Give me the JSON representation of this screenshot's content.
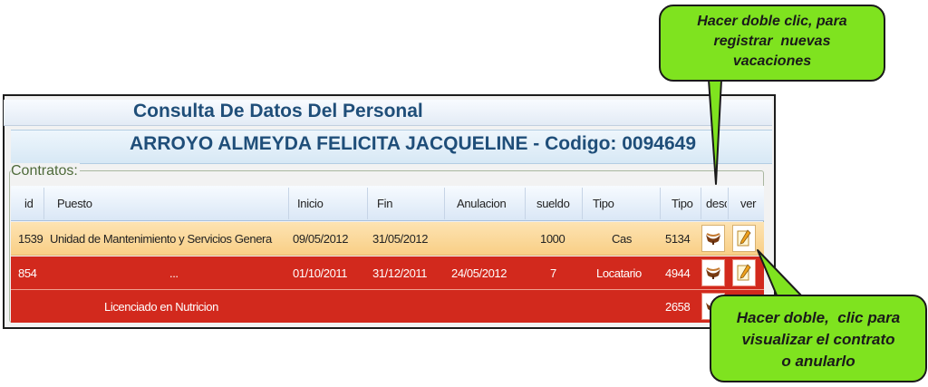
{
  "page": {
    "title": "Consulta De Datos Del Personal",
    "person_line": "ARROYO ALMEYDA FELICITA JACQUELINE - Codigo: 0094649"
  },
  "contracts": {
    "legend": "Contratos:",
    "headers": [
      "id",
      "Puesto",
      "Inicio",
      "Fin",
      "Anulacion",
      "sueldo",
      "Tipo",
      "Tipo",
      "desc",
      "ver"
    ],
    "rows": [
      {
        "id": "1539",
        "puesto": "Unidad de Mantenimiento y Servicios Genera",
        "inicio": "09/05/2012",
        "fin": "31/05/2012",
        "anulacion": "",
        "sueldo": "1000",
        "tipo": "Cas",
        "tipo2": "5134"
      },
      {
        "id": "854",
        "puesto": "...",
        "inicio": "01/10/2011",
        "fin": "31/12/2011",
        "anulacion": "24/05/2012",
        "sueldo": "7",
        "tipo": "Locatario",
        "tipo2": "4944"
      },
      {
        "id": "",
        "puesto": "Licenciado en Nutricion",
        "inicio": "",
        "fin": "",
        "anulacion": "",
        "sueldo": "",
        "tipo": "",
        "tipo2": "2658"
      }
    ],
    "row_colors": [
      "#f9cf86",
      "#d2291d",
      "#d2291d"
    ]
  },
  "callouts": {
    "top": [
      "Hacer doble clic, para",
      "registrar  nuevas",
      "vacaciones"
    ],
    "bottom": [
      "Hacer doble,  clic para",
      "visualizar el contrato",
      "o anularlo"
    ]
  },
  "icons": {
    "desc": "vacation-cup-icon",
    "ver": "edit-document-icon"
  },
  "colors": {
    "callout": "#7fe31f",
    "title": "#1f4e79"
  }
}
